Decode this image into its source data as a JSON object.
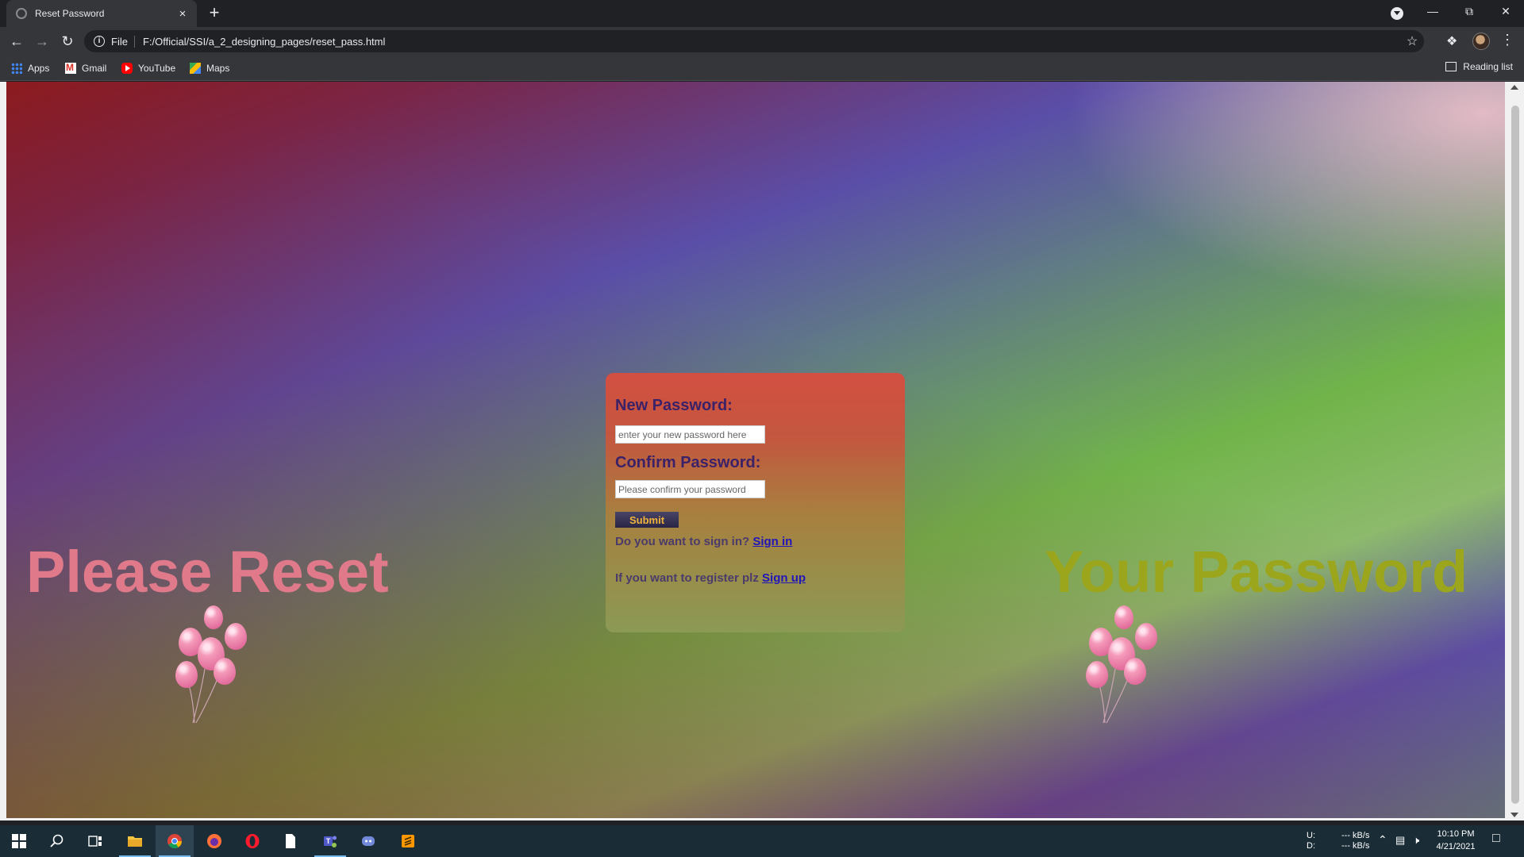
{
  "browser": {
    "tab_title": "Reset Password",
    "tab_close": "×",
    "new_tab": "+",
    "scheme_label": "File",
    "url": "F:/Official/SSI/a_2_designing_pages/reset_pass.html",
    "bookmarks": [
      {
        "label": "Apps",
        "icon": "apps-grid-icon"
      },
      {
        "label": "Gmail",
        "icon": "gmail-icon"
      },
      {
        "label": "YouTube",
        "icon": "youtube-icon"
      },
      {
        "label": "Maps",
        "icon": "maps-icon"
      }
    ],
    "reading_list": "Reading list"
  },
  "page": {
    "headline_left": "Please Reset",
    "headline_right": "Your Password",
    "form": {
      "new_password_label": "New Password:",
      "new_password_placeholder": "enter your new password here",
      "new_password_value": "",
      "confirm_password_label": "Confirm Password:",
      "confirm_password_placeholder": "Please confirm your password",
      "confirm_password_value": "",
      "submit_label": "Submit",
      "signin_prompt": "Do you want to sign in?",
      "signin_link": "Sign in",
      "signup_prompt": "If you want to register plz",
      "signup_link": "Sign up"
    },
    "colors": {
      "headline_left": "#e07a8a",
      "headline_right": "#9ba61c",
      "label": "#3b2168",
      "link": "#2215b8",
      "submit_text": "#f2b43c"
    }
  },
  "taskbar": {
    "apps": [
      "start-icon",
      "search-icon",
      "task-view-icon",
      "file-explorer-icon",
      "chrome-icon",
      "firefox-icon",
      "opera-icon",
      "notepad-icon",
      "teams-icon",
      "discord-icon",
      "sublime-icon"
    ],
    "net_label_up": "U:",
    "net_label_down": "D:",
    "net_up": "--- kB/s",
    "net_down": "--- kB/s",
    "time": "10:10 PM",
    "date": "4/21/2021"
  }
}
